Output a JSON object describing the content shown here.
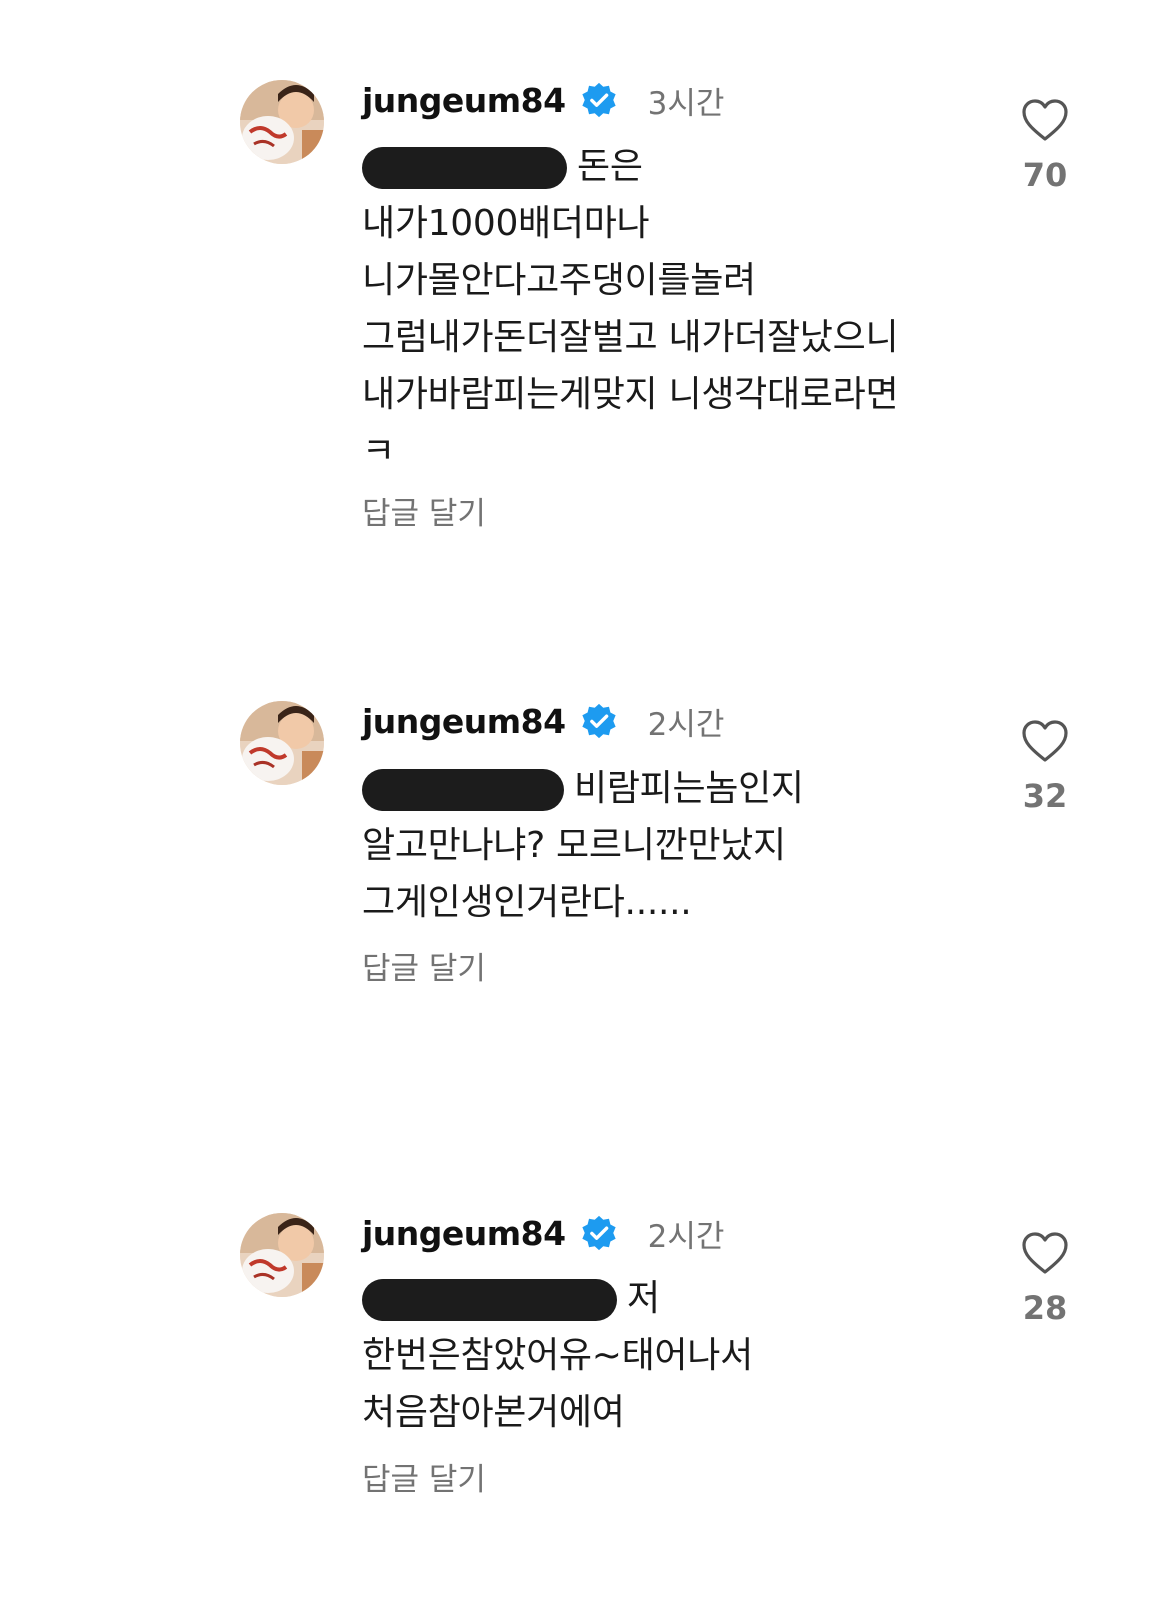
{
  "comments": [
    {
      "username": "jungeum84",
      "time": "3시간",
      "lines": [
        "돈은",
        "내가1000배더마나",
        "니가몰안다고주댕이를놀려",
        "그럼내가돈더잘벌고 내가더잘났으니",
        "내가바람피는게맞지 니생각대로라면",
        "ㅋ"
      ],
      "reply_label": "답글 달기",
      "likes": "70"
    },
    {
      "username": "jungeum84",
      "time": "2시간",
      "lines": [
        "비람피는놈인지",
        "알고만나냐? 모르니깐만났지",
        "그게인생인거란다......"
      ],
      "reply_label": "답글 달기",
      "likes": "32"
    },
    {
      "username": "jungeum84",
      "time": "2시간",
      "lines": [
        "저",
        "한번은참았어유~태어나서",
        "처음참아본거에여"
      ],
      "reply_label": "답글 달기",
      "likes": "28"
    }
  ],
  "colors": {
    "verified_blue": "#1d9bf0",
    "muted_text": "#737373",
    "redaction": "#1c1c1c"
  },
  "icons": [
    "verified-badge-icon",
    "heart-outline-icon"
  ]
}
